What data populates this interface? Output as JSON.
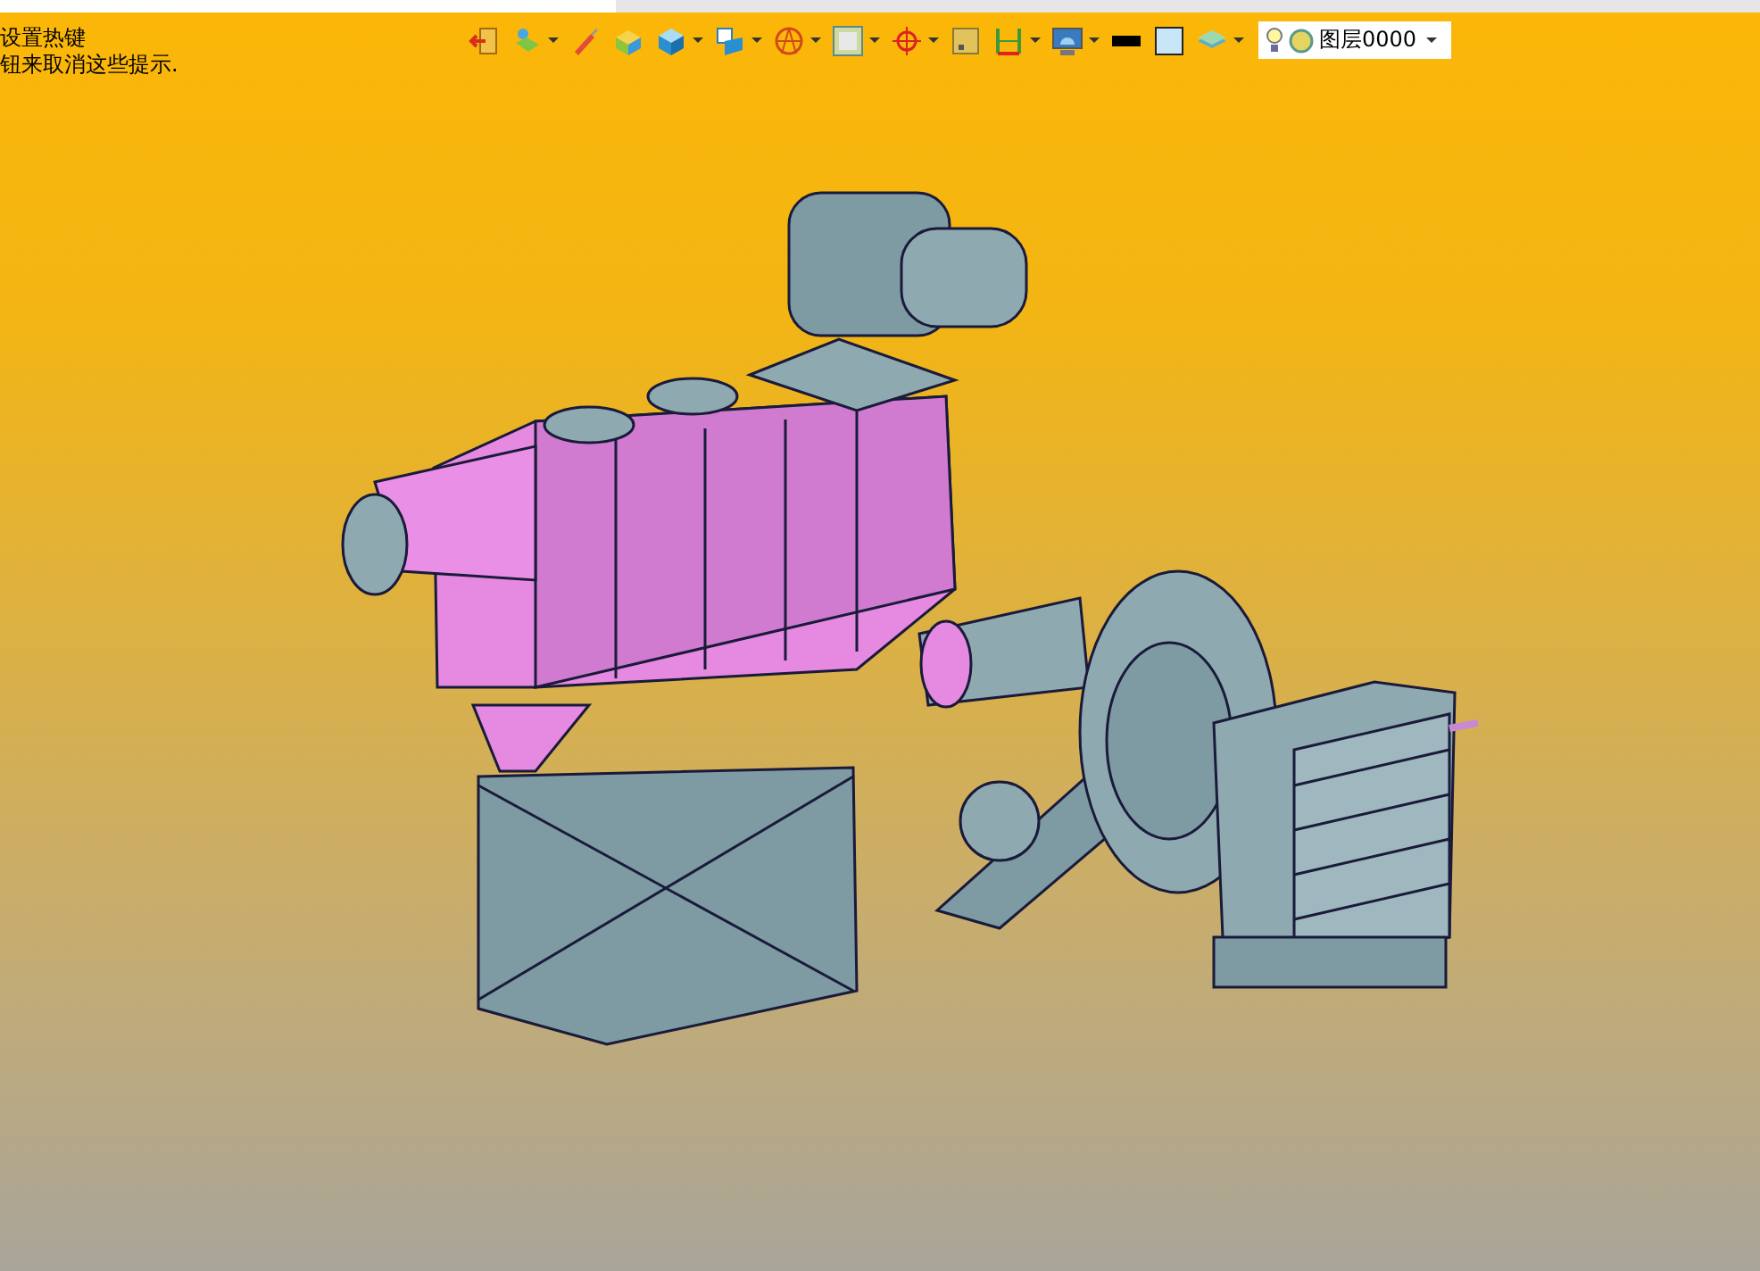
{
  "hint": {
    "lines": [
      "设置热键",
      "钮来取消这些提示."
    ]
  },
  "toolbar": [
    {
      "dropdown": false
    },
    {
      "dropdown": true
    },
    {
      "dropdown": false
    },
    {
      "dropdown": false
    },
    {
      "dropdown": true
    },
    {
      "dropdown": true
    },
    {
      "dropdown": true
    },
    {
      "dropdown": true
    },
    {
      "dropdown": true
    },
    {
      "dropdown": false
    },
    {
      "dropdown": true
    },
    {
      "dropdown": true
    },
    {
      "dropdown": false
    },
    {
      "dropdown": false
    },
    {
      "dropdown": true
    }
  ],
  "layer": {
    "value": "图层0000"
  }
}
